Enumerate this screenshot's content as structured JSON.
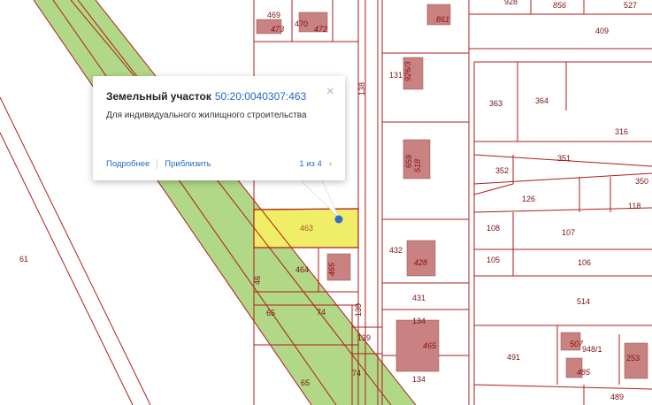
{
  "popup": {
    "title": "Земельный участок",
    "cadastral_number": "50:20:0040307:463",
    "description": "Для индивидуального жилищного строительства",
    "more_label": "Подробнее",
    "zoom_label": "Приблизить",
    "pager": "1 из 4",
    "close": "×",
    "next": "›"
  },
  "parcel_labels": {
    "p469": "469",
    "p473": "473",
    "p470": "470",
    "p472": "472",
    "p861": "861",
    "p928": "928",
    "p856": "856",
    "p527": "527",
    "p409": "409",
    "p131": "131",
    "p926": "926/3",
    "p138": "138",
    "p363": "363",
    "p364": "364",
    "p316": "316",
    "p351": "351",
    "p352": "352",
    "p350": "350",
    "p518": "518",
    "p659": "659",
    "p126": "126",
    "p118": "118",
    "p463": "463",
    "p108": "108",
    "p107": "107",
    "p432": "432",
    "p428": "428",
    "p105": "105",
    "p106": "106",
    "p61": "61",
    "p464": "464",
    "p465a": "465",
    "p46": "46",
    "p65a": "65",
    "p74a": "74",
    "p139a": "139",
    "p139b": "139",
    "p431": "431",
    "p514": "514",
    "p134a": "134",
    "p465b": "465",
    "p507": "507",
    "p948": "948/1",
    "p253": "253",
    "p491": "491",
    "p485": "485",
    "p74b": "74",
    "p65b": "65",
    "p134b": "134",
    "p489": "489"
  },
  "colors": {
    "boundary": "#b01c1c",
    "green_zone": "#a8d47a",
    "highlight": "#f2f06a",
    "building": "#c98282",
    "link": "#2468c7"
  }
}
